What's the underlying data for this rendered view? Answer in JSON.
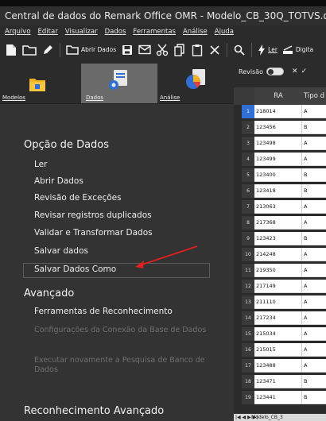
{
  "window": {
    "title": "Central de dados do Remark Office OMR - Modelo_CB_30Q_TOTVS.omr [Un"
  },
  "menu": [
    "Arquivo",
    "Editar",
    "Visualizar",
    "Dados",
    "Ferramentas",
    "Análise",
    "Ajuda"
  ],
  "toolbar": {
    "open_data_label": "Abrir Dados",
    "read_label": "Ler",
    "digitize_label": "Digita"
  },
  "nav_tabs": {
    "models": "Modelos",
    "data": "Dados",
    "analysis": "Análise",
    "active": "Dados"
  },
  "panel": {
    "section1_title": "Opção de Dados",
    "section1_items": [
      "Ler",
      "Abrir Dados",
      "Revisão de Exceções",
      "Revisar registros duplicados",
      "Validar e Transformar Dados",
      "Salvar dados",
      "Salvar Dados Como"
    ],
    "section2_title": "Avançado",
    "section2_items": [
      "Ferramentas de Reconhecimento",
      "Configurações da Conexão da Base de Dados",
      "Executar novamente a Pesquisa de Banco de Dados"
    ],
    "section3_title": "Reconhecimento Avançado"
  },
  "grid": {
    "review_label": "Revisão",
    "columns": [
      "RA",
      "Tipo d"
    ],
    "rows": [
      {
        "n": "1",
        "ra": "218014",
        "tipo": "A"
      },
      {
        "n": "2",
        "ra": "123456",
        "tipo": "B"
      },
      {
        "n": "3",
        "ra": "123498",
        "tipo": "A"
      },
      {
        "n": "4",
        "ra": "123499",
        "tipo": "A"
      },
      {
        "n": "5",
        "ra": "123400",
        "tipo": "B"
      },
      {
        "n": "6",
        "ra": "123418",
        "tipo": "B"
      },
      {
        "n": "7",
        "ra": "213063",
        "tipo": "A"
      },
      {
        "n": "8",
        "ra": "217368",
        "tipo": "A"
      },
      {
        "n": "9",
        "ra": "123423",
        "tipo": "B"
      },
      {
        "n": "10",
        "ra": "214248",
        "tipo": "A"
      },
      {
        "n": "11",
        "ra": "219350",
        "tipo": "A"
      },
      {
        "n": "12",
        "ra": "217149",
        "tipo": "A"
      },
      {
        "n": "13",
        "ra": "211110",
        "tipo": "A"
      },
      {
        "n": "14",
        "ra": "217234",
        "tipo": "A"
      },
      {
        "n": "15",
        "ra": "215034",
        "tipo": "A"
      },
      {
        "n": "16",
        "ra": "215015",
        "tipo": "A"
      },
      {
        "n": "17",
        "ra": "123488",
        "tipo": "A"
      },
      {
        "n": "18",
        "ra": "123471",
        "tipo": "B"
      },
      {
        "n": "19",
        "ra": "123441",
        "tipo": "B"
      }
    ],
    "footer_sheet": "Modelo_CB_3"
  },
  "colors": {
    "background": "#2b2b2b",
    "panel": "#333333",
    "active_tab": "#6a6a6a",
    "selected_row_number": "#2f6fd6",
    "annotation_arrow": "#e02020"
  }
}
